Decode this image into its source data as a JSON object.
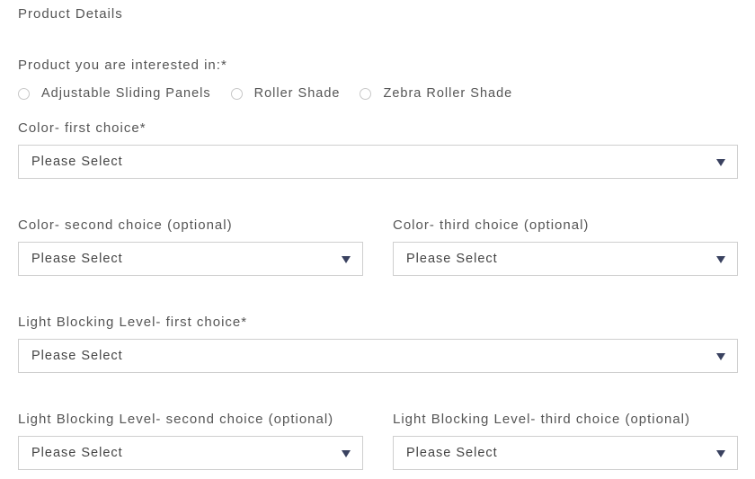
{
  "section": {
    "title": "Product Details"
  },
  "product": {
    "label": "Product you are interested in:*",
    "options": [
      {
        "label": "Adjustable Sliding Panels",
        "selected": false
      },
      {
        "label": "Roller Shade",
        "selected": false
      },
      {
        "label": "Zebra Roller Shade",
        "selected": false
      }
    ]
  },
  "fields": {
    "color_first": {
      "label": "Color- first choice*",
      "value": "Please Select"
    },
    "color_second": {
      "label": "Color- second choice (optional)",
      "value": "Please Select"
    },
    "color_third": {
      "label": "Color- third choice (optional)",
      "value": "Please Select"
    },
    "light_first": {
      "label": "Light Blocking Level- first choice*",
      "value": "Please Select"
    },
    "light_second": {
      "label": "Light Blocking Level- second choice (optional)",
      "value": "Please Select"
    },
    "light_third": {
      "label": "Light Blocking Level- third choice (optional)",
      "value": "Please Select"
    }
  },
  "icons": {
    "dropdown": "caret-down-icon",
    "radio": "radio-unchecked-icon"
  },
  "colors": {
    "caret": "#3a4260",
    "border": "#cfcfcf",
    "text": "#555555"
  }
}
